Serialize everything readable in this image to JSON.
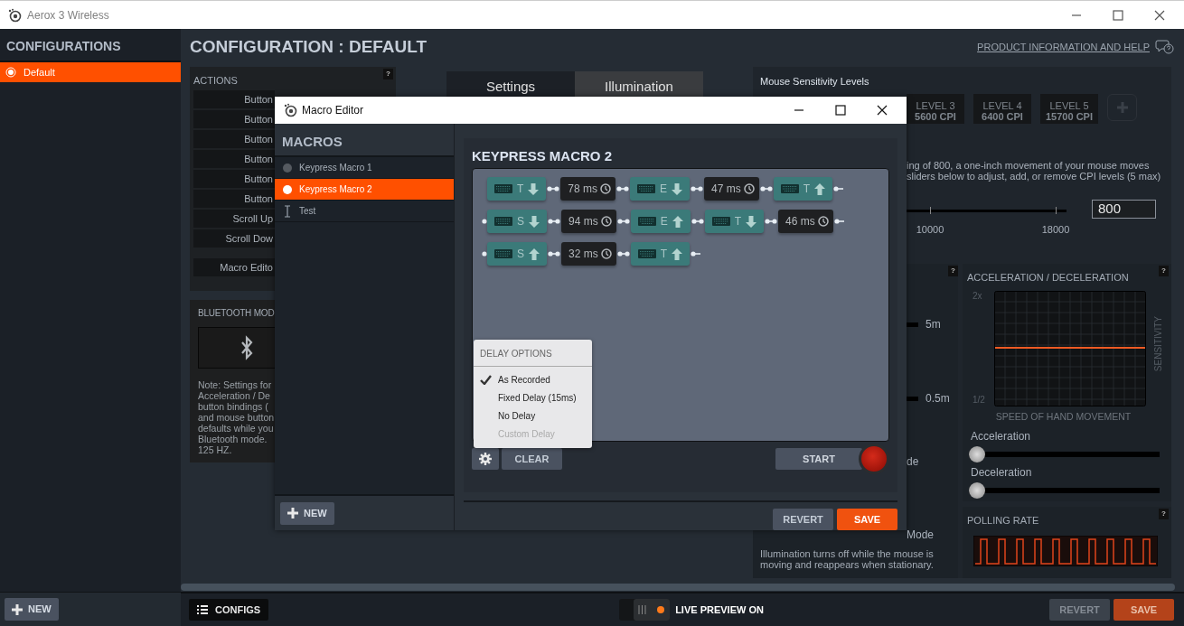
{
  "window": {
    "title": "Aerox 3 Wireless"
  },
  "sidebar": {
    "title": "CONFIGURATIONS",
    "items": [
      {
        "label": "Default",
        "selected": true
      }
    ],
    "new_button": "NEW"
  },
  "header": {
    "title": "CONFIGURATION : DEFAULT",
    "help_link": "PRODUCT INFORMATION AND HELP"
  },
  "actions": {
    "title": "ACTIONS",
    "help": "?",
    "rows": [
      "Button",
      "Button",
      "Button",
      "Button",
      "Button",
      "Button",
      "Scroll Up",
      "Scroll Dow"
    ],
    "macro_editor": "Macro Edito"
  },
  "bluetooth": {
    "title": "BLUETOOTH MOD",
    "note_lines": [
      "Note: Settings for",
      "Acceleration / De",
      "button bindings (",
      "and mouse button",
      "defaults while you",
      "Bluetooth mode.",
      "125 HZ."
    ]
  },
  "tabs": [
    {
      "label": "Settings",
      "selected": true
    },
    {
      "label": "Illumination",
      "selected": false
    }
  ],
  "sensitivity": {
    "title": "Mouse Sensitivity Levels",
    "levels": [
      {
        "label": "LEVEL 3",
        "value": "5600 CPI"
      },
      {
        "label": "LEVEL 4",
        "value": "6400 CPI"
      },
      {
        "label": "LEVEL 5",
        "value": "15700 CPI"
      }
    ],
    "description_lines": [
      "ing of 800, a one-inch movement of your mouse moves",
      "sliders below to adjust, add, or remove CPI levels (5 max)"
    ],
    "ticks": [
      "10000",
      "18000"
    ],
    "value": "800"
  },
  "illumination": {
    "help": "?",
    "readings": [
      "5m",
      "0.5m"
    ],
    "fragments": [
      "de",
      "Mode"
    ],
    "note": "Illumination turns off while the mouse is moving and reappears when stationary."
  },
  "acceleration": {
    "title": "ACCELERATION / DECELERATION",
    "help": "?",
    "y_top": "2x",
    "y_bottom": "1/2",
    "y_label": "SENSITIVITY",
    "x_label": "SPEED OF HAND MOVEMENT",
    "sliders": [
      {
        "label": "Acceleration",
        "level": 0
      },
      {
        "label": "Deceleration",
        "level": 0
      }
    ]
  },
  "polling": {
    "title": "POLLING RATE",
    "help": "?"
  },
  "footer": {
    "configs": "CONFIGS",
    "live_preview": {
      "label": "LIVE PREVIEW ON",
      "on": true
    },
    "revert": "REVERT",
    "save": "SAVE"
  },
  "macro_editor": {
    "title": "Macro Editor",
    "list_title": "MACROS",
    "macros": [
      {
        "label": "Keypress Macro 1",
        "kind": "macro",
        "selected": false
      },
      {
        "label": "Keypress Macro 2",
        "kind": "macro",
        "selected": true
      },
      {
        "label": "Test",
        "kind": "text",
        "selected": false
      }
    ],
    "new_button": "NEW",
    "macro_title": "KEYPRESS MACRO 2",
    "rows": [
      [
        {
          "kind": "keydown",
          "key": "T"
        },
        {
          "kind": "delay",
          "text": "78 ms"
        },
        {
          "kind": "keydown",
          "key": "E"
        },
        {
          "kind": "delay",
          "text": "47 ms"
        },
        {
          "kind": "keyup",
          "key": "T"
        }
      ],
      [
        {
          "kind": "keydown",
          "key": "S"
        },
        {
          "kind": "delay",
          "text": "94 ms"
        },
        {
          "kind": "keyup",
          "key": "E"
        },
        {
          "kind": "keydown",
          "key": "T"
        },
        {
          "kind": "delay",
          "text": "46 ms"
        }
      ],
      [
        {
          "kind": "keyup",
          "key": "S"
        },
        {
          "kind": "delay",
          "text": "32 ms"
        },
        {
          "kind": "keyup",
          "key": "T"
        }
      ]
    ],
    "clear": "CLEAR",
    "start": "START",
    "revert": "REVERT",
    "save": "SAVE",
    "delay_menu": {
      "title": "DELAY OPTIONS",
      "options": [
        {
          "label": "As Recorded",
          "checked": true,
          "disabled": false
        },
        {
          "label": "Fixed Delay (15ms)",
          "checked": false,
          "disabled": false
        },
        {
          "label": "No Delay",
          "checked": false,
          "disabled": false
        },
        {
          "label": "Custom Delay",
          "checked": false,
          "disabled": true
        }
      ]
    }
  }
}
